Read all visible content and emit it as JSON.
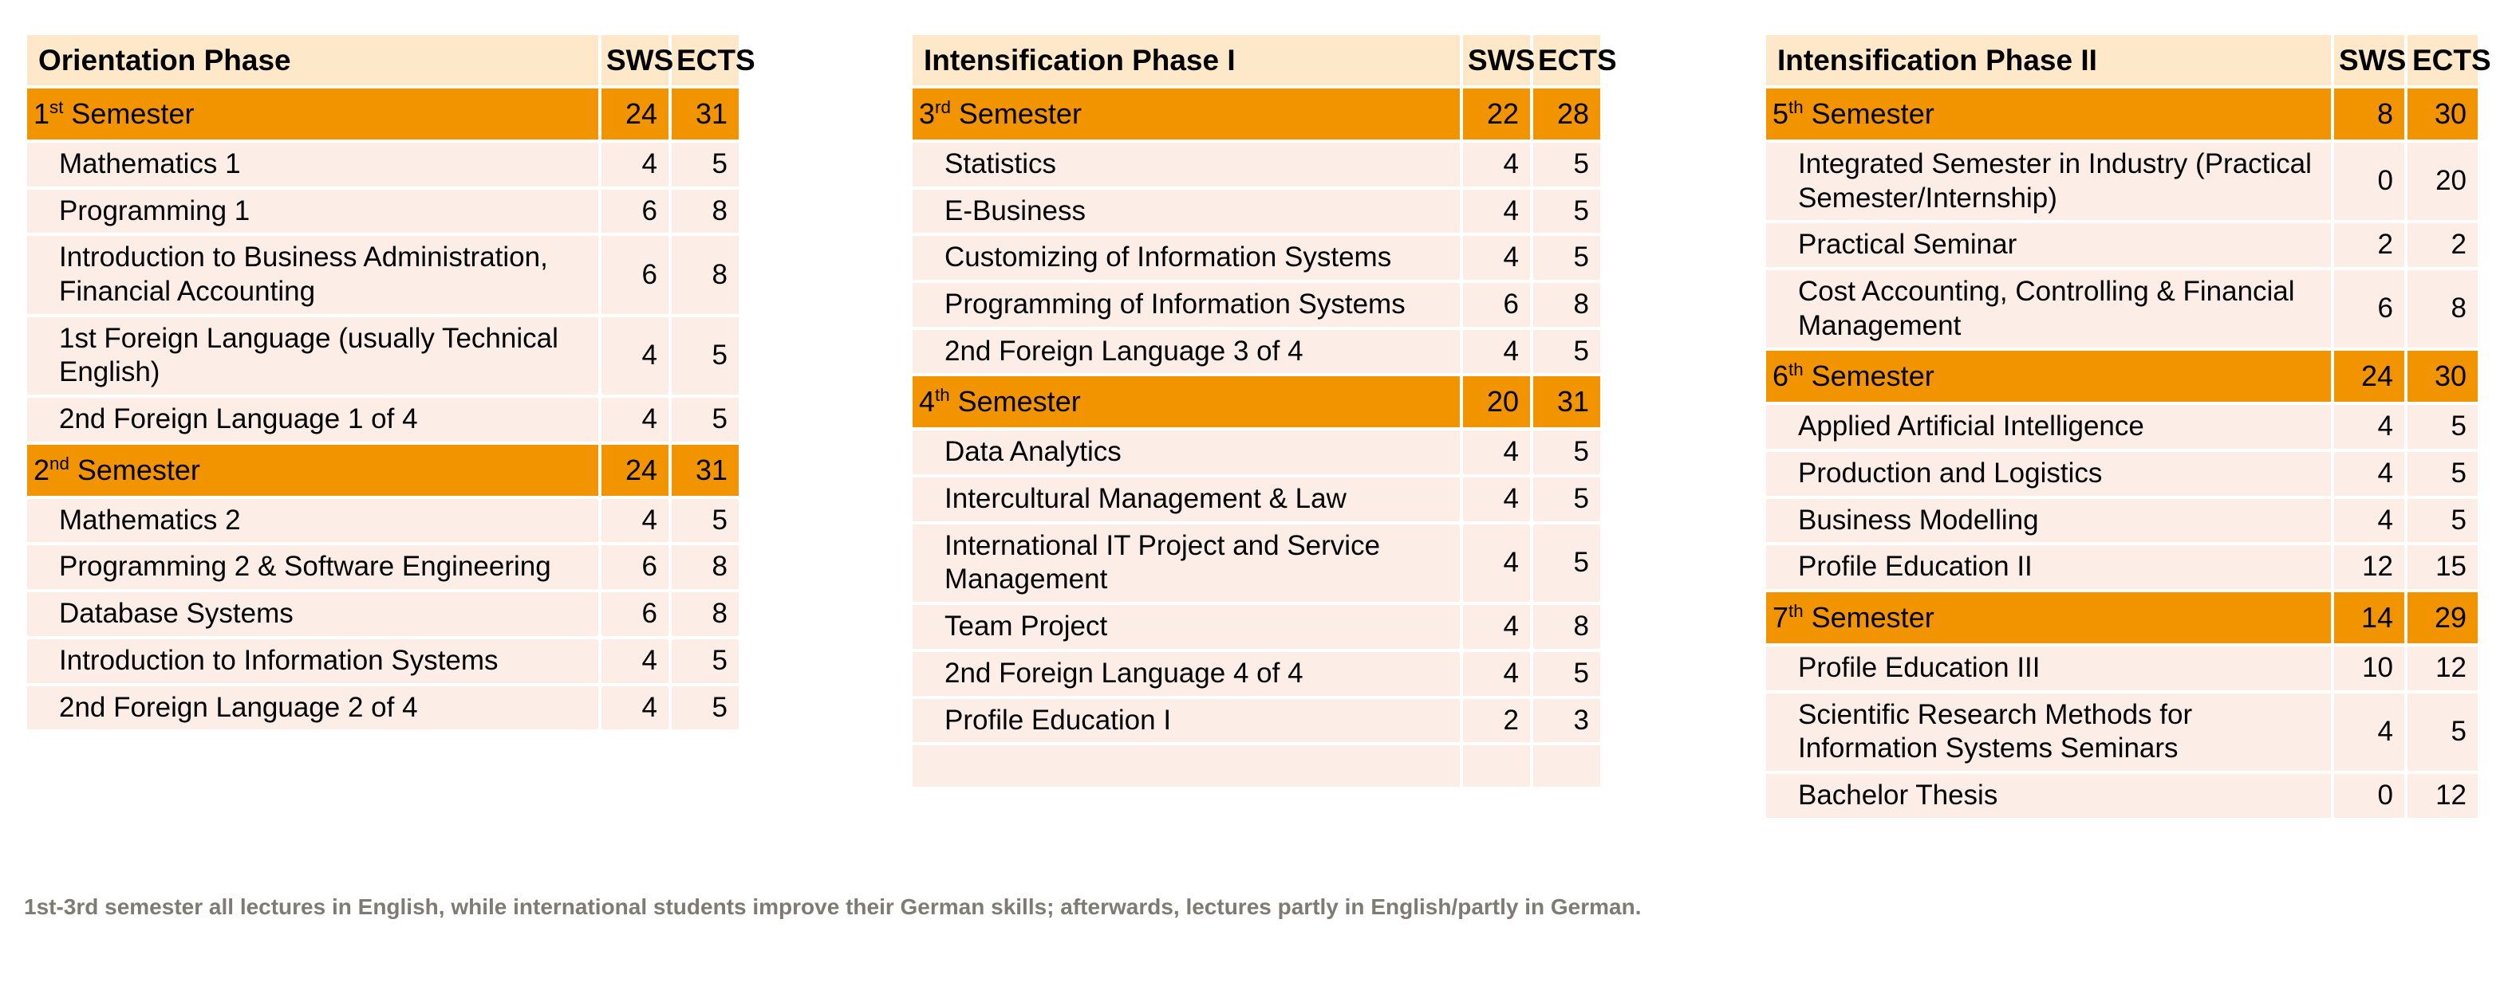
{
  "columns": {
    "name_header_placeholder": "",
    "sws": "SWS",
    "ects": "ECTS"
  },
  "colors": {
    "header_bg": "#FDE8CA",
    "semester_bg": "#F29400",
    "course_bg": "#FCEDE7",
    "page_bg": "#FFFFFF",
    "footnote_text": "#7F7A72"
  },
  "tables": [
    {
      "title": "Orientation Phase",
      "sws_label": "SWS",
      "ects_label": "ECTS",
      "rows": [
        {
          "type": "semester",
          "ordinal": "1",
          "suffix": "st",
          "label": " Semester",
          "sws": "24",
          "ects": "31"
        },
        {
          "type": "course",
          "label": "Mathematics 1",
          "sws": "4",
          "ects": "5"
        },
        {
          "type": "course",
          "label": "Programming 1",
          "sws": "6",
          "ects": "8"
        },
        {
          "type": "course",
          "label": "Introduction to Business Administration, Financial Accounting",
          "sws": "6",
          "ects": "8"
        },
        {
          "type": "course",
          "label": "1st Foreign Language (usually Technical English)",
          "sws": "4",
          "ects": "5"
        },
        {
          "type": "course",
          "label": "2nd Foreign Language 1 of 4",
          "sws": "4",
          "ects": "5"
        },
        {
          "type": "semester",
          "ordinal": "2",
          "suffix": "nd",
          "label": " Semester",
          "sws": "24",
          "ects": "31"
        },
        {
          "type": "course",
          "label": "Mathematics 2",
          "sws": "4",
          "ects": "5"
        },
        {
          "type": "course",
          "label": "Programming 2 & Software Engineering",
          "sws": "6",
          "ects": "8"
        },
        {
          "type": "course",
          "label": "Database Systems",
          "sws": "6",
          "ects": "8"
        },
        {
          "type": "course",
          "label": "Introduction to Information Systems",
          "sws": "4",
          "ects": "5"
        },
        {
          "type": "course",
          "label": "2nd Foreign Language 2 of 4",
          "sws": "4",
          "ects": "5"
        }
      ]
    },
    {
      "title": "Intensification Phase I",
      "sws_label": "SWS",
      "ects_label": "ECTS",
      "rows": [
        {
          "type": "semester",
          "ordinal": "3",
          "suffix": "rd",
          "label": " Semester",
          "sws": "22",
          "ects": "28"
        },
        {
          "type": "course",
          "label": "Statistics",
          "sws": "4",
          "ects": "5"
        },
        {
          "type": "course",
          "label": "E-Business",
          "sws": "4",
          "ects": "5"
        },
        {
          "type": "course",
          "label": "Customizing of Information Systems",
          "sws": "4",
          "ects": "5"
        },
        {
          "type": "course",
          "label": "Programming of Information Systems",
          "sws": "6",
          "ects": "8"
        },
        {
          "type": "course",
          "label": "2nd Foreign Language 3 of 4",
          "sws": "4",
          "ects": "5"
        },
        {
          "type": "semester",
          "ordinal": "4",
          "suffix": "th",
          "label": " Semester",
          "sws": "20",
          "ects": "31"
        },
        {
          "type": "course",
          "label": "Data Analytics",
          "sws": "4",
          "ects": "5"
        },
        {
          "type": "course",
          "label": "Intercultural Management & Law",
          "sws": "4",
          "ects": "5"
        },
        {
          "type": "course",
          "label": "International IT Project and Service Management",
          "sws": "4",
          "ects": "5"
        },
        {
          "type": "course",
          "label": "Team Project",
          "sws": "4",
          "ects": "8"
        },
        {
          "type": "course",
          "label": "2nd Foreign Language 4 of 4",
          "sws": "4",
          "ects": "5"
        },
        {
          "type": "course",
          "label": "Profile Education I",
          "sws": "2",
          "ects": "3"
        },
        {
          "type": "blank",
          "label": "",
          "sws": "",
          "ects": ""
        }
      ]
    },
    {
      "title": "Intensification Phase II",
      "sws_label": "SWS",
      "ects_label": "ECTS",
      "rows": [
        {
          "type": "semester",
          "ordinal": "5",
          "suffix": "th",
          "label": " Semester",
          "sws": "8",
          "ects": "30"
        },
        {
          "type": "course",
          "label": "Integrated Semester in Industry (Practical Semester/Internship)",
          "sws": "0",
          "ects": "20"
        },
        {
          "type": "course",
          "label": "Practical Seminar",
          "sws": "2",
          "ects": "2"
        },
        {
          "type": "course",
          "label": "Cost Accounting, Controlling & Financial Management",
          "sws": "6",
          "ects": "8"
        },
        {
          "type": "semester",
          "ordinal": "6",
          "suffix": "th",
          "label": " Semester",
          "sws": "24",
          "ects": "30"
        },
        {
          "type": "course",
          "label": "Applied Artificial Intelligence",
          "sws": "4",
          "ects": "5"
        },
        {
          "type": "course",
          "label": "Production and Logistics",
          "sws": "4",
          "ects": "5"
        },
        {
          "type": "course",
          "label": "Business Modelling",
          "sws": "4",
          "ects": "5"
        },
        {
          "type": "course",
          "label": "Profile Education II",
          "sws": "12",
          "ects": "15"
        },
        {
          "type": "semester",
          "ordinal": "7",
          "suffix": "th",
          "label": " Semester",
          "sws": "14",
          "ects": "29"
        },
        {
          "type": "course",
          "label": "Profile Education III",
          "sws": "10",
          "ects": "12"
        },
        {
          "type": "course",
          "label": "Scientific Research Methods for Information Systems Seminars",
          "sws": "4",
          "ects": "5"
        },
        {
          "type": "course",
          "label": "Bachelor Thesis",
          "sws": "0",
          "ects": "12"
        }
      ]
    }
  ],
  "footnote": "1st-3rd semester all lectures in English, while international students improve their German skills; afterwards, lectures partly in English/partly in German."
}
